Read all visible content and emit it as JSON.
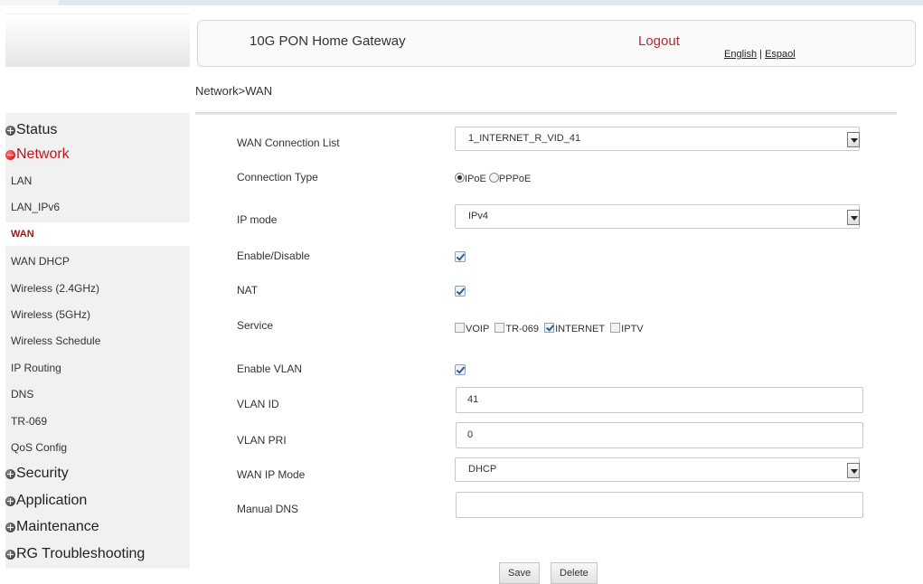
{
  "header": {
    "title": "10G PON Home Gateway",
    "logout_label": "Logout",
    "lang_english": "English",
    "lang_separator": "|",
    "lang_spanish": "Espaol"
  },
  "breadcrumb": "Network>WAN",
  "sidebar": {
    "sections": [
      {
        "label": "Status"
      },
      {
        "label": "Network"
      }
    ],
    "network_items": [
      {
        "label": "LAN"
      },
      {
        "label": "LAN_IPv6"
      },
      {
        "label": "WAN",
        "active": true
      },
      {
        "label": "WAN DHCP"
      },
      {
        "label": "Wireless (2.4GHz)"
      },
      {
        "label": "Wireless (5GHz)"
      },
      {
        "label": "Wireless Schedule"
      },
      {
        "label": "IP Routing"
      },
      {
        "label": "DNS"
      },
      {
        "label": "TR-069"
      },
      {
        "label": "QoS Config"
      }
    ],
    "lower_sections": [
      {
        "label": "Security"
      },
      {
        "label": "Application"
      },
      {
        "label": "Maintenance"
      },
      {
        "label": "RG Troubleshooting"
      }
    ]
  },
  "form": {
    "wan_connection_list": {
      "label": "WAN Connection List",
      "value": "1_INTERNET_R_VID_41"
    },
    "connection_type": {
      "label": "Connection Type",
      "options": [
        "IPoE",
        "PPPoE"
      ],
      "selected": "IPoE"
    },
    "ip_mode": {
      "label": "IP mode",
      "value": "IPv4"
    },
    "enable_disable": {
      "label": "Enable/Disable",
      "checked": true
    },
    "nat": {
      "label": "NAT",
      "checked": true
    },
    "service": {
      "label": "Service",
      "options": [
        {
          "label": "VOIP",
          "checked": false
        },
        {
          "label": "TR-069",
          "checked": false
        },
        {
          "label": "INTERNET",
          "checked": true
        },
        {
          "label": "IPTV",
          "checked": false
        }
      ]
    },
    "enable_vlan": {
      "label": "Enable VLAN",
      "checked": true
    },
    "vlan_id": {
      "label": "VLAN ID",
      "value": "41"
    },
    "vlan_pri": {
      "label": "VLAN PRI",
      "value": "0"
    },
    "wan_ip_mode": {
      "label": "WAN IP Mode",
      "value": "DHCP"
    },
    "manual_dns": {
      "label": "Manual DNS",
      "value": ""
    }
  },
  "buttons": {
    "save": "Save",
    "delete": "Delete"
  }
}
